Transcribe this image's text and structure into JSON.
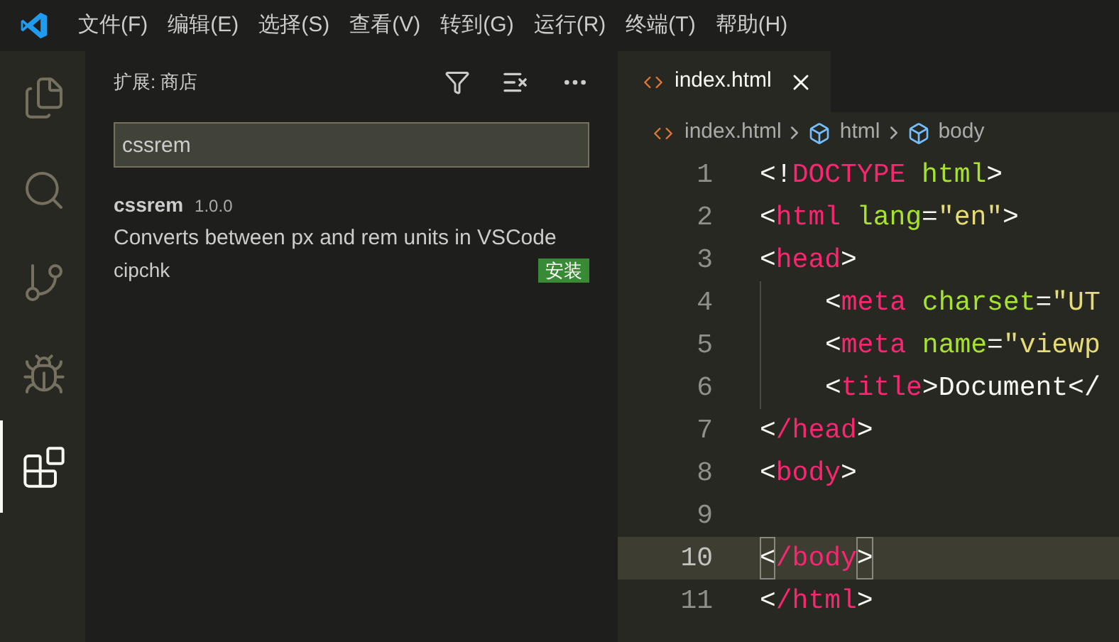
{
  "menu": [
    "文件(F)",
    "编辑(E)",
    "选择(S)",
    "查看(V)",
    "转到(G)",
    "运行(R)",
    "终端(T)",
    "帮助(H)"
  ],
  "activity_bar": [
    {
      "kind": "files",
      "selected": false
    },
    {
      "kind": "search",
      "selected": false
    },
    {
      "kind": "source-control",
      "selected": false
    },
    {
      "kind": "debug",
      "selected": false
    },
    {
      "kind": "extensions",
      "selected": true
    }
  ],
  "sidebar": {
    "title": "扩展: 商店",
    "search": {
      "value": "cssrem"
    },
    "extensions": [
      {
        "name": "cssrem",
        "version": "1.0.0",
        "description": "Converts between px and rem units in VSCode",
        "publisher": "cipchk",
        "action": "安装"
      }
    ]
  },
  "tabs": [
    {
      "label": "index.html",
      "selected": true
    }
  ],
  "breadcrumb": [
    {
      "kind": "file",
      "label": "index.html"
    },
    {
      "kind": "element",
      "label": "html"
    },
    {
      "kind": "element",
      "label": "body"
    }
  ],
  "code": [
    {
      "number": "1",
      "current": false,
      "tokens": [
        {
          "kind": "punct",
          "text": "<!"
        },
        {
          "kind": "tag",
          "text": "DOCTYPE"
        },
        {
          "kind": "attr",
          "text": " html"
        },
        {
          "kind": "punct",
          "text": ">"
        }
      ]
    },
    {
      "number": "2",
      "current": false,
      "tokens": [
        {
          "kind": "punct",
          "text": "<"
        },
        {
          "kind": "tag",
          "text": "html"
        },
        {
          "kind": "attr",
          "text": " lang"
        },
        {
          "kind": "punct",
          "text": "="
        },
        {
          "kind": "string",
          "text": "\"en\""
        },
        {
          "kind": "punct",
          "text": ">"
        }
      ]
    },
    {
      "number": "3",
      "current": false,
      "tokens": [
        {
          "kind": "punct",
          "text": "<"
        },
        {
          "kind": "tag",
          "text": "head"
        },
        {
          "kind": "punct",
          "text": ">"
        }
      ]
    },
    {
      "number": "4",
      "current": false,
      "indented": true,
      "tokens": [
        {
          "kind": "punct",
          "text": "<"
        },
        {
          "kind": "tag",
          "text": "meta"
        },
        {
          "kind": "attr",
          "text": " charset"
        },
        {
          "kind": "punct",
          "text": "="
        },
        {
          "kind": "string",
          "text": "\"UT"
        }
      ]
    },
    {
      "number": "5",
      "current": false,
      "indented": true,
      "tokens": [
        {
          "kind": "punct",
          "text": "<"
        },
        {
          "kind": "tag",
          "text": "meta"
        },
        {
          "kind": "attr",
          "text": " name"
        },
        {
          "kind": "punct",
          "text": "="
        },
        {
          "kind": "string",
          "text": "\"viewp"
        }
      ]
    },
    {
      "number": "6",
      "current": false,
      "indented": true,
      "tokens": [
        {
          "kind": "punct",
          "text": "<"
        },
        {
          "kind": "tag",
          "text": "title"
        },
        {
          "kind": "punct",
          "text": ">Document</"
        }
      ]
    },
    {
      "number": "7",
      "current": false,
      "tokens": [
        {
          "kind": "punct",
          "text": "<"
        },
        {
          "kind": "tag",
          "text": "/head"
        },
        {
          "kind": "punct",
          "text": ">"
        }
      ]
    },
    {
      "number": "8",
      "current": false,
      "tokens": [
        {
          "kind": "punct",
          "text": "<"
        },
        {
          "kind": "tag",
          "text": "body"
        },
        {
          "kind": "punct",
          "text": ">"
        }
      ]
    },
    {
      "number": "9",
      "current": false
    },
    {
      "number": "10",
      "current": true,
      "tokens": [
        {
          "kind": "match",
          "text": "<"
        },
        {
          "kind": "tag",
          "text": "/body"
        },
        {
          "kind": "match",
          "text": ">"
        }
      ]
    },
    {
      "number": "11",
      "current": false,
      "tokens": [
        {
          "kind": "punct",
          "text": "<"
        },
        {
          "kind": "tag",
          "text": "/html"
        },
        {
          "kind": "punct",
          "text": ">"
        }
      ]
    }
  ]
}
